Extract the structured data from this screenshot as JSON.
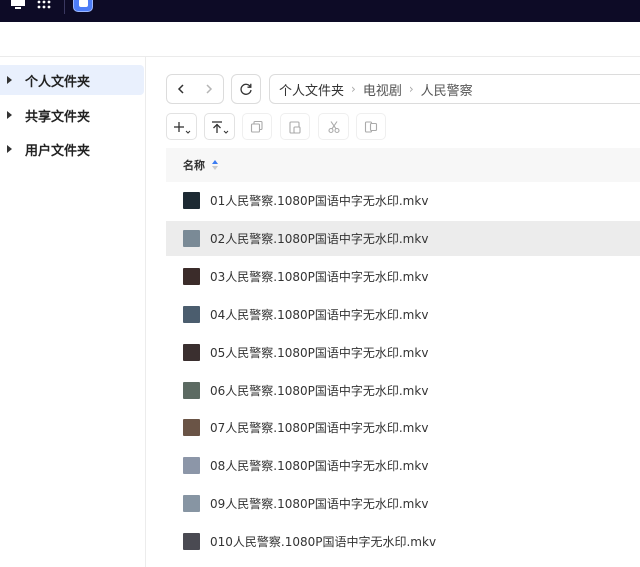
{
  "colors": {
    "topbar": "#0d0b26",
    "sidebar_active": "#e9f0fd",
    "accent": "#3a7bf2",
    "row_selected": "#ececec"
  },
  "sidebar": {
    "items": [
      {
        "label": "个人文件夹",
        "active": true
      },
      {
        "label": "共享文件夹",
        "active": false
      },
      {
        "label": "用户文件夹",
        "active": false
      }
    ]
  },
  "toolbar": {
    "back_icon": "chevron-left-icon",
    "forward_icon": "chevron-right-icon",
    "refresh_icon": "refresh-icon",
    "actions": [
      "new-icon",
      "upload-icon",
      "copy-icon",
      "paste-icon",
      "cut-icon",
      "move-icon"
    ]
  },
  "breadcrumb": [
    "个人文件夹",
    "电视剧",
    "人民警察"
  ],
  "list": {
    "column_name": "名称",
    "sort": "ascending",
    "files": [
      {
        "name": "01人民警察.1080P国语中字无水印.mkv",
        "thumb_color": "#1d2a33",
        "selected": false
      },
      {
        "name": "02人民警察.1080P国语中字无水印.mkv",
        "thumb_color": "#7a8a96",
        "selected": true
      },
      {
        "name": "03人民警察.1080P国语中字无水印.mkv",
        "thumb_color": "#3b2c2a",
        "selected": false
      },
      {
        "name": "04人民警察.1080P国语中字无水印.mkv",
        "thumb_color": "#4b5d6e",
        "selected": false
      },
      {
        "name": "05人民警察.1080P国语中字无水印.mkv",
        "thumb_color": "#3a2f2f",
        "selected": false
      },
      {
        "name": "06人民警察.1080P国语中字无水印.mkv",
        "thumb_color": "#5c6a62",
        "selected": false
      },
      {
        "name": "07人民警察.1080P国语中字无水印.mkv",
        "thumb_color": "#6a5446",
        "selected": false
      },
      {
        "name": "08人民警察.1080P国语中字无水印.mkv",
        "thumb_color": "#8c96a8",
        "selected": false
      },
      {
        "name": "09人民警察.1080P国语中字无水印.mkv",
        "thumb_color": "#8795a3",
        "selected": false
      },
      {
        "name": "010人民警察.1080P国语中字无水印.mkv",
        "thumb_color": "#4a4a52",
        "selected": false
      }
    ]
  }
}
